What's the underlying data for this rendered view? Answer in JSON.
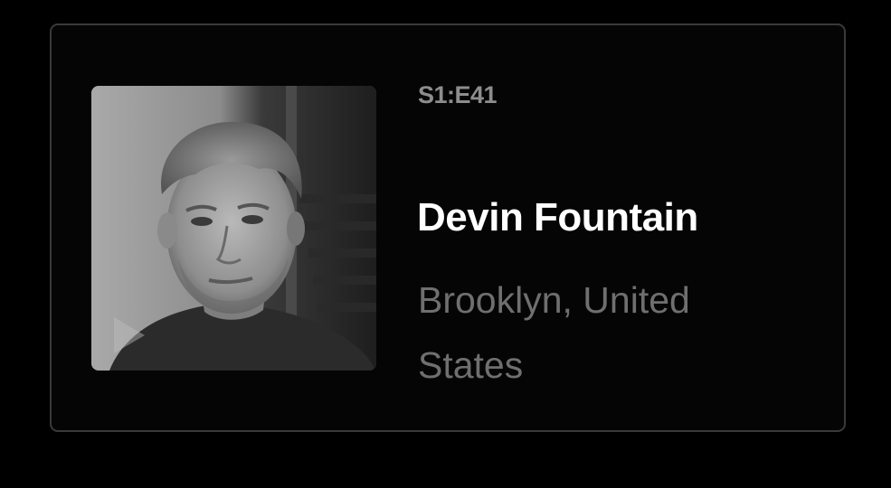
{
  "episode": {
    "code": "S1:E41",
    "guest_name": "Devin Fountain",
    "location": "Brooklyn, United States"
  },
  "colors": {
    "background": "#000000",
    "card_border": "#3a3a3a",
    "name": "#ffffff",
    "episode_code": "#8d8d8d",
    "location": "#6f6f6f"
  },
  "icons": {
    "thumbnail_overlay": "play-icon"
  }
}
